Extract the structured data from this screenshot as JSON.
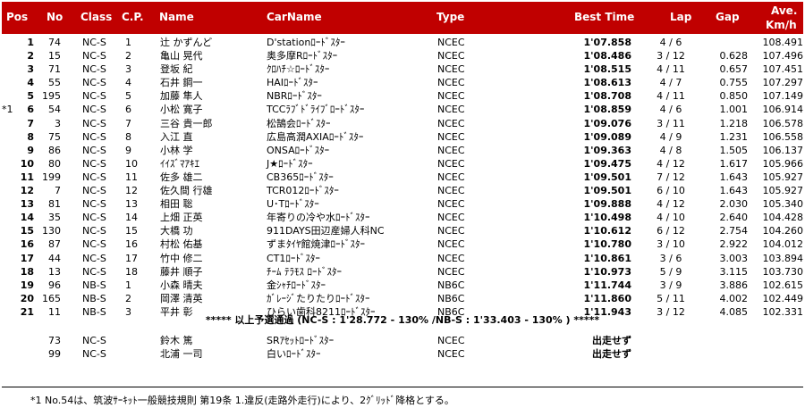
{
  "header": {
    "pos": "Pos",
    "no": "No",
    "class": "Class",
    "cp": "C.P.",
    "name": "Name",
    "carname": "CarName",
    "type": "Type",
    "best_time": "Best Time",
    "lap": "Lap",
    "gap": "Gap",
    "ave_line1": "Ave.",
    "ave_line2": "Km/h"
  },
  "rows": [
    {
      "note": "",
      "pos": "1",
      "no": "74",
      "class": "NC-S",
      "cp": "1",
      "name": "辻 かずんど",
      "car": "D'stationﾛｰﾄﾞｽﾀｰ",
      "type": "NCEC",
      "best": "1'07.858",
      "lap": "4 / 6",
      "gap": "",
      "ave": "108.491"
    },
    {
      "note": "",
      "pos": "2",
      "no": "15",
      "class": "NC-S",
      "cp": "2",
      "name": "亀山 晃代",
      "car": "奥多摩Rﾛｰﾄﾞｽﾀｰ",
      "type": "NCEC",
      "best": "1'08.486",
      "lap": "3 / 12",
      "gap": "0.628",
      "ave": "107.496"
    },
    {
      "note": "",
      "pos": "3",
      "no": "71",
      "class": "NC-S",
      "cp": "3",
      "name": "登坂 紀",
      "car": "ｸﾛﾊﾁ☆ﾛｰﾄﾞｽﾀｰ",
      "type": "NCEC",
      "best": "1'08.515",
      "lap": "4 / 11",
      "gap": "0.657",
      "ave": "107.451"
    },
    {
      "note": "",
      "pos": "4",
      "no": "55",
      "class": "NC-S",
      "cp": "4",
      "name": "石井 鋼一",
      "car": "HAIﾛｰﾄﾞｽﾀｰ",
      "type": "NCEC",
      "best": "1'08.613",
      "lap": "4 / 7",
      "gap": "0.755",
      "ave": "107.297"
    },
    {
      "note": "",
      "pos": "5",
      "no": "195",
      "class": "NC-S",
      "cp": "5",
      "name": "加藤 隼人",
      "car": "NBRﾛｰﾄﾞｽﾀｰ",
      "type": "NCEC",
      "best": "1'08.708",
      "lap": "4 / 11",
      "gap": "0.850",
      "ave": "107.149"
    },
    {
      "note": "*1",
      "pos": "6",
      "no": "54",
      "class": "NC-S",
      "cp": "6",
      "name": "小松 寛子",
      "car": "TCCﾗﾌﾞﾄﾞﾗｲﾌﾞﾛｰﾄﾞｽﾀｰ",
      "type": "NCEC",
      "best": "1'08.859",
      "lap": "4 / 6",
      "gap": "1.001",
      "ave": "106.914"
    },
    {
      "note": "",
      "pos": "7",
      "no": "3",
      "class": "NC-S",
      "cp": "7",
      "name": "三谷 貴一郎",
      "car": "松鵠会ﾛｰﾄﾞｽﾀｰ",
      "type": "NCEC",
      "best": "1'09.076",
      "lap": "3 / 11",
      "gap": "1.218",
      "ave": "106.578"
    },
    {
      "note": "",
      "pos": "8",
      "no": "75",
      "class": "NC-S",
      "cp": "8",
      "name": "入江 直",
      "car": "広島高潤AXIAﾛｰﾄﾞｽﾀｰ",
      "type": "NCEC",
      "best": "1'09.089",
      "lap": "4 / 9",
      "gap": "1.231",
      "ave": "106.558"
    },
    {
      "note": "",
      "pos": "9",
      "no": "86",
      "class": "NC-S",
      "cp": "9",
      "name": "小林 学",
      "car": "ONSAﾛｰﾄﾞｽﾀｰ",
      "type": "NCEC",
      "best": "1'09.363",
      "lap": "4 / 8",
      "gap": "1.505",
      "ave": "106.137"
    },
    {
      "note": "",
      "pos": "10",
      "no": "80",
      "class": "NC-S",
      "cp": "10",
      "name": "ｲｲｽﾞﾏｱｷｴ",
      "car": "J★ﾛｰﾄﾞｽﾀｰ",
      "type": "NCEC",
      "best": "1'09.475",
      "lap": "4 / 12",
      "gap": "1.617",
      "ave": "105.966"
    },
    {
      "note": "",
      "pos": "11",
      "no": "199",
      "class": "NC-S",
      "cp": "11",
      "name": "佐多 雄二",
      "car": "CB365ﾛｰﾄﾞｽﾀｰ",
      "type": "NCEC",
      "best": "1'09.501",
      "lap": "7 / 12",
      "gap": "1.643",
      "ave": "105.927"
    },
    {
      "note": "",
      "pos": "12",
      "no": "7",
      "class": "NC-S",
      "cp": "12",
      "name": "佐久間 行雄",
      "car": "TCR012ﾛｰﾄﾞｽﾀｰ",
      "type": "NCEC",
      "best": "1'09.501",
      "lap": "6 / 10",
      "gap": "1.643",
      "ave": "105.927"
    },
    {
      "note": "",
      "pos": "13",
      "no": "81",
      "class": "NC-S",
      "cp": "13",
      "name": "相田 聡",
      "car": "U･Tﾛｰﾄﾞｽﾀｰ",
      "type": "NCEC",
      "best": "1'09.888",
      "lap": "4 / 12",
      "gap": "2.030",
      "ave": "105.340"
    },
    {
      "note": "",
      "pos": "14",
      "no": "35",
      "class": "NC-S",
      "cp": "14",
      "name": "上畑 正英",
      "car": "年寄りの冷や水ﾛｰﾄﾞｽﾀｰ",
      "type": "NCEC",
      "best": "1'10.498",
      "lap": "4 / 10",
      "gap": "2.640",
      "ave": "104.428"
    },
    {
      "note": "",
      "pos": "15",
      "no": "130",
      "class": "NC-S",
      "cp": "15",
      "name": "大橋 功",
      "car": "911DAYS田辺産婦人科NC",
      "type": "NCEC",
      "best": "1'10.612",
      "lap": "6 / 12",
      "gap": "2.754",
      "ave": "104.260"
    },
    {
      "note": "",
      "pos": "16",
      "no": "87",
      "class": "NC-S",
      "cp": "16",
      "name": "村松 佑基",
      "car": "ずまﾀｲﾔ館焼津ﾛｰﾄﾞｽﾀｰ",
      "type": "NCEC",
      "best": "1'10.780",
      "lap": "3 / 10",
      "gap": "2.922",
      "ave": "104.012"
    },
    {
      "note": "",
      "pos": "17",
      "no": "44",
      "class": "NC-S",
      "cp": "17",
      "name": "竹中 修二",
      "car": "CT1ﾛｰﾄﾞｽﾀｰ",
      "type": "NCEC",
      "best": "1'10.861",
      "lap": "3 / 6",
      "gap": "3.003",
      "ave": "103.894"
    },
    {
      "note": "",
      "pos": "18",
      "no": "13",
      "class": "NC-S",
      "cp": "18",
      "name": "藤井 順子",
      "car": "ﾁｰﾑ ﾃﾗﾓｽ ﾛｰﾄﾞｽﾀｰ",
      "type": "NCEC",
      "best": "1'10.973",
      "lap": "5 / 9",
      "gap": "3.115",
      "ave": "103.730"
    },
    {
      "note": "",
      "pos": "19",
      "no": "96",
      "class": "NB-S",
      "cp": "1",
      "name": "小森 晴夫",
      "car": "金ｼｬﾁﾛｰﾄﾞｽﾀｰ",
      "type": "NB6C",
      "best": "1'11.744",
      "lap": "3 / 9",
      "gap": "3.886",
      "ave": "102.615"
    },
    {
      "note": "",
      "pos": "20",
      "no": "165",
      "class": "NB-S",
      "cp": "2",
      "name": "岡澤 清英",
      "car": "ｶﾞﾚｰｼﾞたりたりﾛｰﾄﾞｽﾀｰ",
      "type": "NB6C",
      "best": "1'11.860",
      "lap": "5 / 11",
      "gap": "4.002",
      "ave": "102.449"
    },
    {
      "note": "",
      "pos": "21",
      "no": "11",
      "class": "NB-S",
      "cp": "3",
      "name": "平井 彰",
      "car": "ひらい歯科8211ﾛｰﾄﾞｽﾀｰ",
      "type": "NB6C",
      "best": "1'11.943",
      "lap": "3 / 12",
      "gap": "4.085",
      "ave": "102.331"
    }
  ],
  "qualify_banner": "***** 以上予選通過 (NC-S : 1'28.772 - 130% /NB-S : 1'33.403 - 130% ) *****",
  "dns_rows": [
    {
      "no": "73",
      "class": "NC-S",
      "name": "鈴木 篤",
      "car": "SRｱｾｯﾄﾛｰﾄﾞｽﾀｰ",
      "type": "NCEC",
      "best": "出走せず"
    },
    {
      "no": "99",
      "class": "NC-S",
      "name": "北浦 一司",
      "car": "白いﾛｰﾄﾞｽﾀｰ",
      "type": "NCEC",
      "best": "出走せず"
    }
  ],
  "footnote": "*1 No.54は、筑波ｻｰｷｯﾄ一般競技規則 第19条 1.違反(走路外走行)により、2ｸﾞﾘｯﾄﾞ降格とする。",
  "colors": {
    "header_bg": "#c00000",
    "header_text": "#ffffff"
  }
}
